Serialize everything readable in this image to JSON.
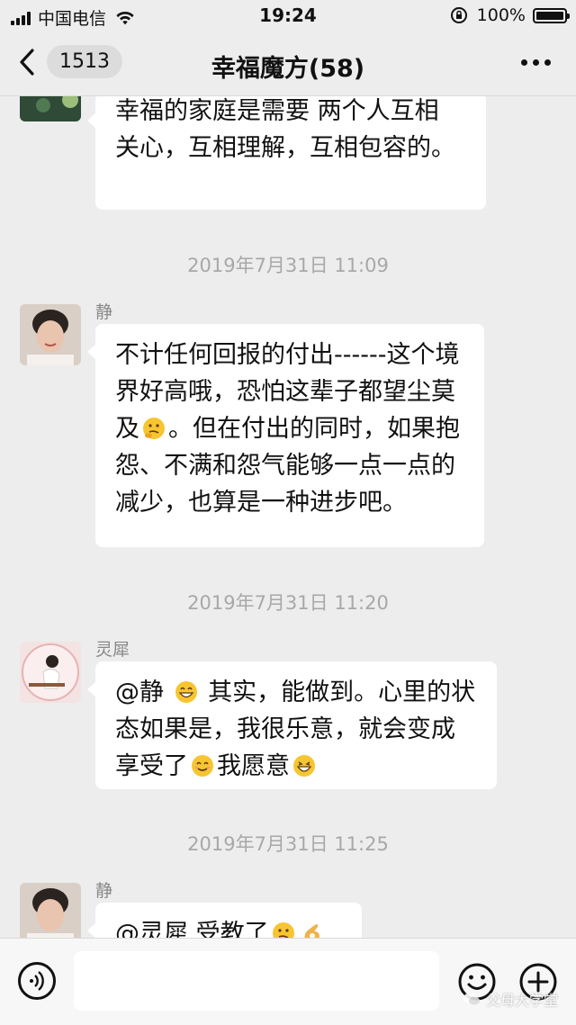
{
  "status_bar": {
    "carrier": "中国电信",
    "time": "19:24",
    "battery": "100%",
    "battery_level": 1.0
  },
  "nav": {
    "back_count": "1513",
    "title": "幸福魔方(58)"
  },
  "messages": [
    {
      "sender": "",
      "text": "幸福的家庭是需要 两个人互相关心，互相理解，互相包容的。"
    },
    {
      "timestamp": "2019年7月31日 11:09"
    },
    {
      "sender": "静",
      "text_parts": [
        "不计任何回报的付出------这个境界好高哦，恐怕这辈子都望尘莫及",
        "。但在付出的同时，如果抱怨、不满和怨气能够一点一点的减少，也算是一种进步吧。"
      ]
    },
    {
      "timestamp": "2019年7月31日 11:20"
    },
    {
      "sender": "灵犀",
      "text_parts": [
        "@静 ",
        " 其实，能做到。心里的状态如果是，我很乐意，就会变成享受了",
        "我愿意"
      ]
    },
    {
      "timestamp": "2019年7月31日 11:25"
    },
    {
      "sender": "静",
      "text_parts": [
        "@灵犀 受教了"
      ]
    }
  ],
  "watermark": "父母大学堂",
  "icons": {
    "back": "chevron-left-icon",
    "more": "ellipsis-icon",
    "voice": "voice-icon",
    "emoji": "smiley-icon",
    "plus": "plus-icon"
  }
}
